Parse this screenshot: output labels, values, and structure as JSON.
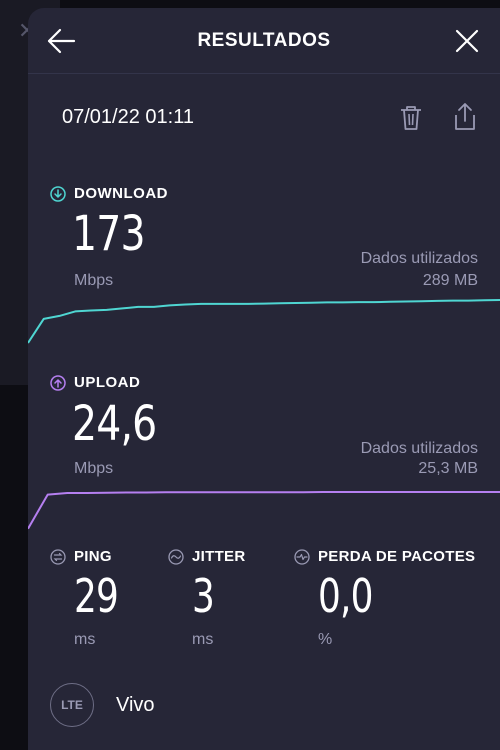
{
  "header": {
    "title": "RESULTADOS"
  },
  "result": {
    "datetime": "07/01/22 01:11"
  },
  "download": {
    "label": "DOWNLOAD",
    "value": "173",
    "unit": "Mbps",
    "data_used_label": "Dados utilizados",
    "data_used_value": "289 MB",
    "color": "#4fd6d2"
  },
  "upload": {
    "label": "UPLOAD",
    "value": "24,6",
    "unit": "Mbps",
    "data_used_label": "Dados utilizados",
    "data_used_value": "25,3 MB",
    "color": "#b57ff0"
  },
  "metrics": {
    "ping": {
      "label": "PING",
      "value": "29",
      "unit": "ms"
    },
    "jitter": {
      "label": "JITTER",
      "value": "3",
      "unit": "ms"
    },
    "packet_loss": {
      "label": "PERDA DE PACOTES",
      "value": "0,0",
      "unit": "%"
    }
  },
  "provider": {
    "badge": "LTE",
    "name": "Vivo"
  },
  "chart_data": [
    {
      "type": "line",
      "series": [
        {
          "values": [
            30,
            110,
            120,
            135,
            138,
            140,
            145,
            150,
            150,
            155,
            158,
            160,
            160,
            160,
            160,
            161,
            162,
            163,
            164,
            165,
            165,
            166,
            166,
            167,
            168,
            169,
            170,
            171,
            171,
            172,
            173
          ]
        }
      ]
    },
    {
      "type": "line",
      "series": [
        {
          "values": [
            2,
            23,
            24,
            24,
            24.2,
            24.3,
            24.3,
            24.4,
            24.4,
            24.4,
            24.5,
            24.5,
            24.5,
            24.5,
            24.5,
            24.6,
            24.6,
            24.6,
            24.6,
            24.6,
            24.6,
            24.6,
            24.6,
            24.6,
            24.6
          ]
        }
      ]
    }
  ]
}
